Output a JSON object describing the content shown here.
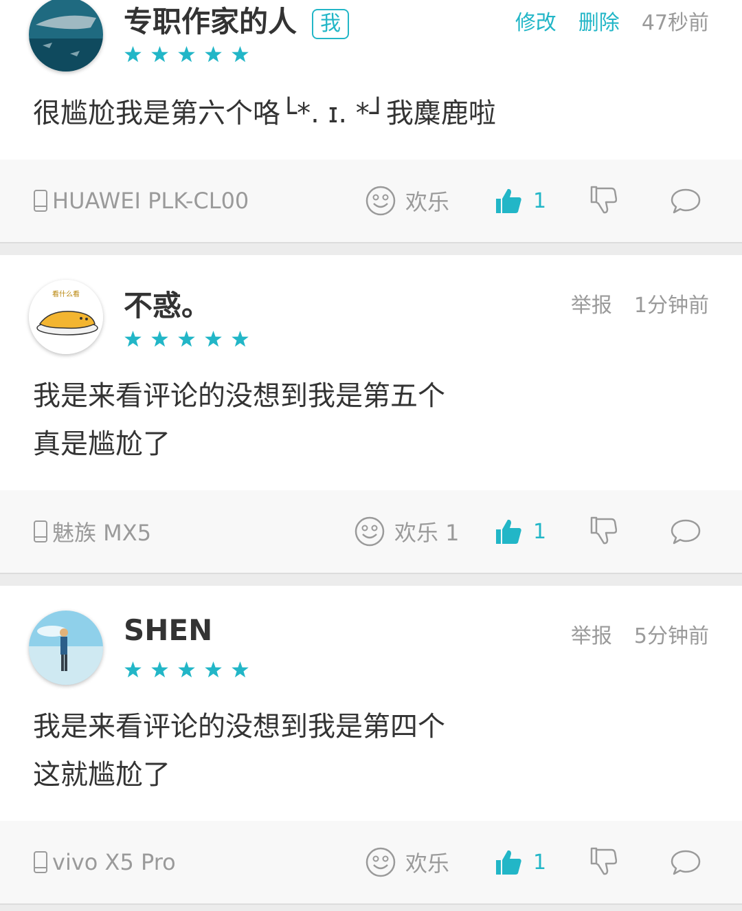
{
  "colors": {
    "accent": "#22b6c7",
    "muted": "#9a9a9a",
    "text": "#333333"
  },
  "comments": [
    {
      "author": "专职作家的人",
      "badge": "我",
      "actions": [
        "修改",
        "删除"
      ],
      "time": "47秒前",
      "rating": 5,
      "text_lines": [
        "很尴尬我是第六个咯└*. ɪ. *┘我麋鹿啦"
      ],
      "device": "HUAWEI PLK-CL00",
      "mood": "欢乐",
      "likes": "1"
    },
    {
      "author": "不惑。",
      "actions": [
        "举报"
      ],
      "time": "1分钟前",
      "rating": 5,
      "text_lines": [
        "我是来看评论的没想到我是第五个",
        "真是尴尬了"
      ],
      "device": "魅族 MX5",
      "mood": "欢乐 1",
      "likes": "1"
    },
    {
      "author": "SHEN",
      "actions": [
        "举报"
      ],
      "time": "5分钟前",
      "rating": 5,
      "text_lines": [
        "我是来看评论的没想到我是第四个",
        "这就尴尬了"
      ],
      "device": "vivo X5 Pro",
      "mood": "欢乐",
      "likes": "1"
    }
  ],
  "avatar2_text": "看什么看"
}
